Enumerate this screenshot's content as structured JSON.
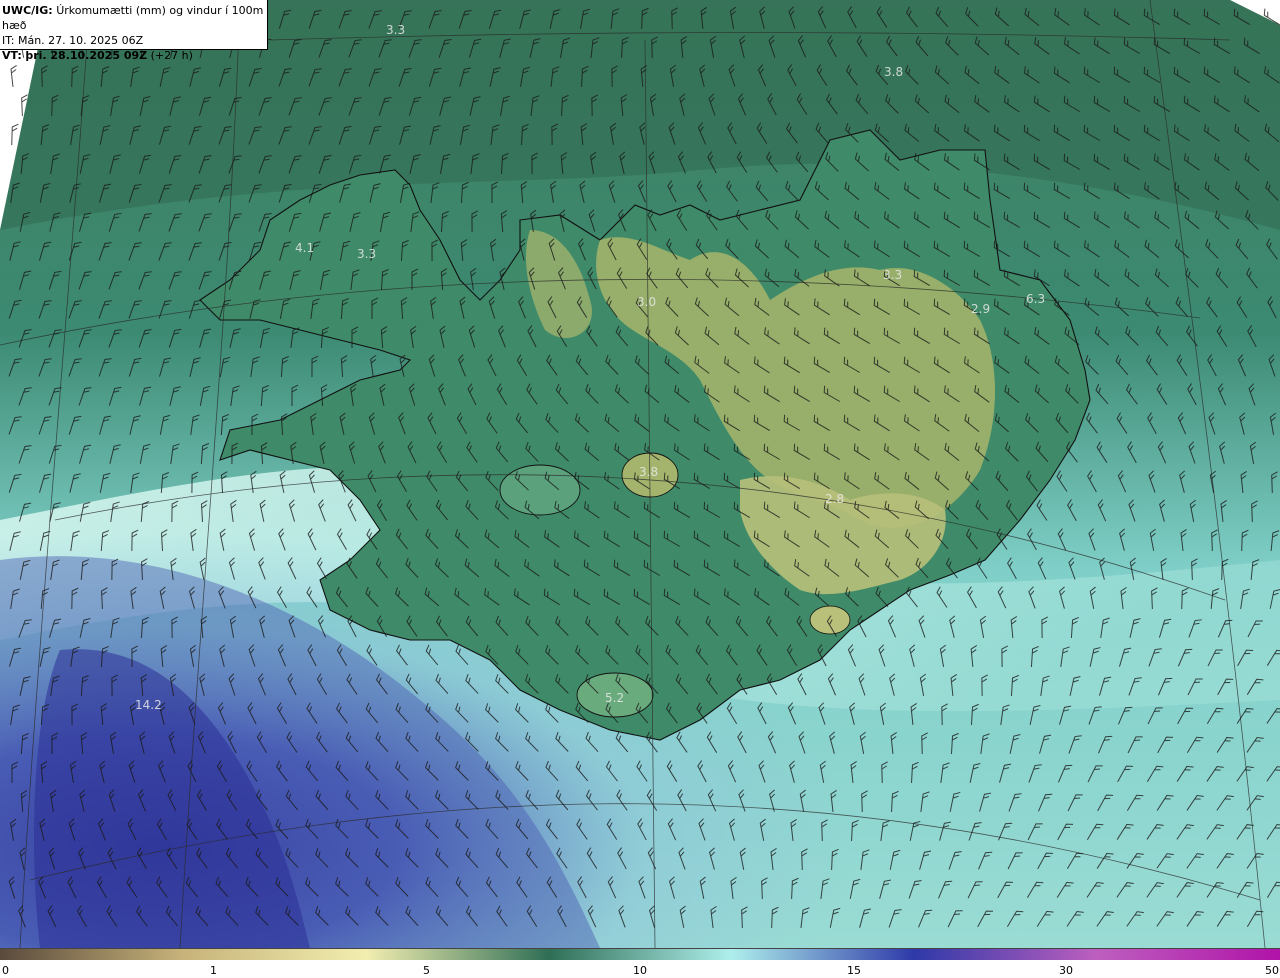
{
  "header": {
    "model": "UWC/IG:",
    "title": "Úrkomumætti (mm) og vindur í 100m hæð",
    "init_time": "IT: Mán. 27. 10. 2025 06Z",
    "valid_prefix": "VT:",
    "valid_time": "þri. 28.10.2025 09Z",
    "lead": "(+27 h)"
  },
  "map": {
    "value_labels": [
      "3.3",
      "3.8",
      "4.1",
      "3.3",
      "3.0",
      "3.3",
      "2.9",
      "6.3",
      "3.8",
      "2.8",
      "5.2",
      "14.2"
    ],
    "wind_barb_color": "#1a1a1a",
    "coastline_color": "#111111"
  },
  "colorbar": {
    "ticks": [
      "0",
      "1",
      "5",
      "10",
      "15",
      "30",
      "50"
    ],
    "colors": [
      "#5a4a3c",
      "#c7b37a",
      "#f2eeb0",
      "#2f6e55",
      "#aeefec",
      "#2e39a8",
      "#bd5fbf",
      "#b013a8"
    ]
  }
}
